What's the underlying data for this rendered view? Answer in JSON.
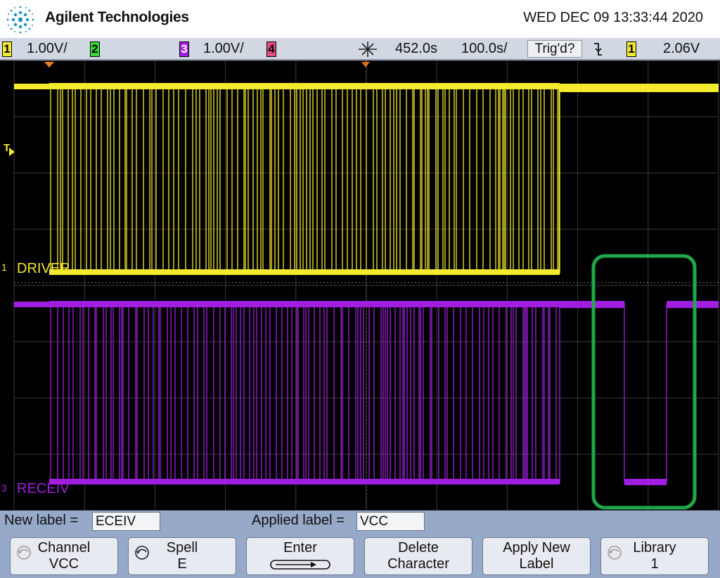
{
  "header": {
    "brand": "Agilent Technologies",
    "datetime": "WED DEC 09 13:33:44 2020"
  },
  "status_bar": {
    "ch1": {
      "number": "1",
      "scale": "1.00V/",
      "color": "#f5eb2e"
    },
    "ch2": {
      "number": "2",
      "color": "#37d836"
    },
    "ch3": {
      "number": "3",
      "scale": "1.00V/",
      "color": "#a11ee0"
    },
    "ch4": {
      "number": "4",
      "color": "#e54b86"
    },
    "delay": "452.0s",
    "timebase": "100.0s/",
    "trigger_status": "Trig'd?",
    "trigger_source": "1",
    "trigger_level": "2.06V"
  },
  "screen": {
    "trigger_marker": "T",
    "channel1_ground": "1",
    "channel1_label": "DRIVER",
    "channel3_ground": "3",
    "channel3_label": "RECEIV",
    "highlight_color": "#1fa84a"
  },
  "label_row": {
    "new_label_caption": "New label =",
    "new_label_value": "ECEIV",
    "applied_label_caption": "Applied label =",
    "applied_label_value": "VCC"
  },
  "softkeys": [
    {
      "line1": "Channel",
      "line2": "VCC"
    },
    {
      "line1": "Spell",
      "line2": "E"
    },
    {
      "line1": "Enter",
      "line2": ""
    },
    {
      "line1": "Delete",
      "line2": "Character"
    },
    {
      "line1": "Apply New",
      "line2": "Label"
    },
    {
      "line1": "Library",
      "line2": "1"
    }
  ]
}
